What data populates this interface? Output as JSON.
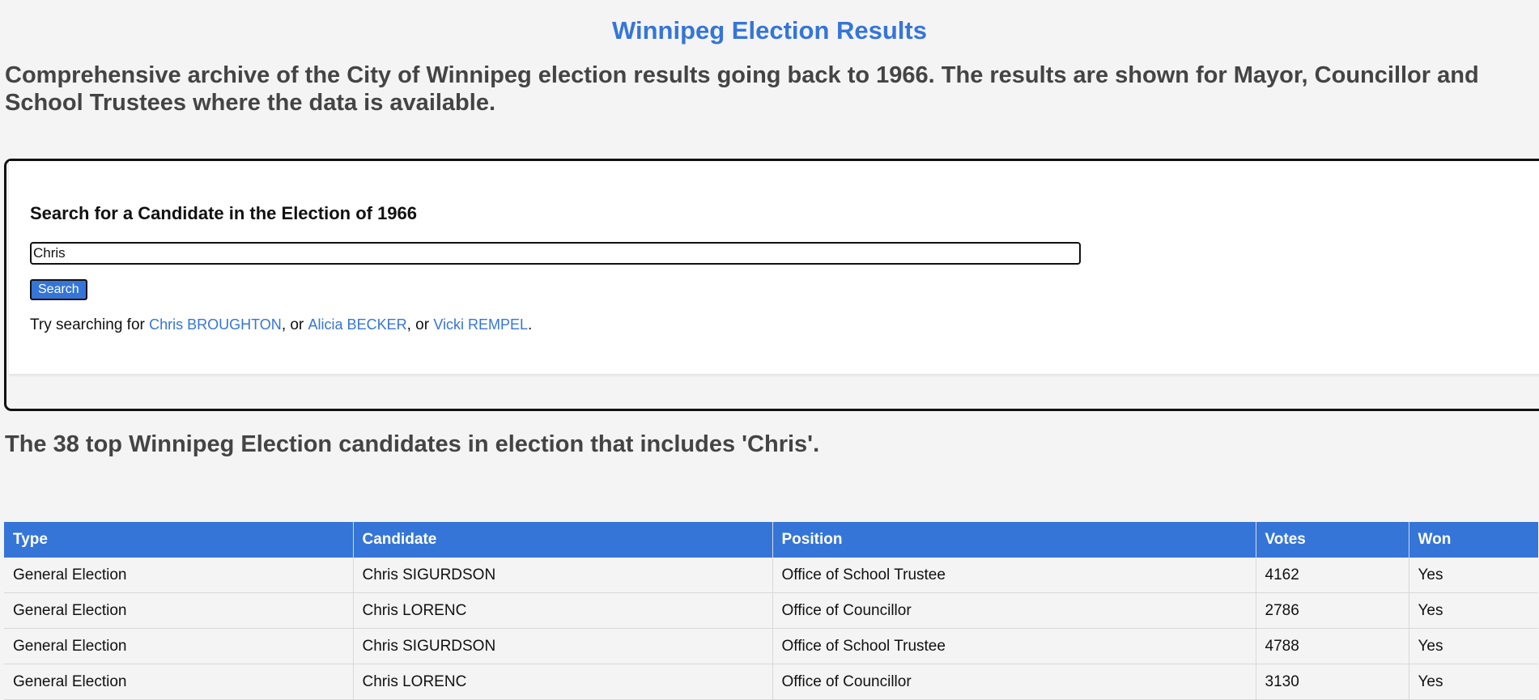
{
  "header": {
    "title": "Winnipeg Election Results",
    "intro": "Comprehensive archive of the City of Winnipeg election results going back to 1966. The results are shown for Mayor, Councillor and School Trustees where the data is available."
  },
  "search": {
    "heading": "Search for a Candidate in the Election of 1966",
    "input_value": "Chris",
    "button_label": "Search",
    "suggestion_prefix": "Try searching for",
    "suggestions": [
      "Chris BROUGHTON",
      "Alicia BECKER",
      "Vicki REMPEL"
    ],
    "separator": ", or",
    "suffix": "."
  },
  "results": {
    "heading": "The 38 top Winnipeg Election candidates in election that includes 'Chris'.",
    "columns": [
      "Type",
      "Candidate",
      "Position",
      "Votes",
      "Won"
    ],
    "rows": [
      [
        "General Election",
        "Chris SIGURDSON",
        "Office of School Trustee",
        "4162",
        "Yes"
      ],
      [
        "General Election",
        "Chris LORENC",
        "Office of Councillor",
        "2786",
        "Yes"
      ],
      [
        "General Election",
        "Chris SIGURDSON",
        "Office of School Trustee",
        "4788",
        "Yes"
      ],
      [
        "General Election",
        "Chris LORENC",
        "Office of Councillor",
        "3130",
        "Yes"
      ]
    ]
  },
  "colors": {
    "accent": "#3575d8",
    "background": "#f4f4f4",
    "text": "#444444"
  }
}
